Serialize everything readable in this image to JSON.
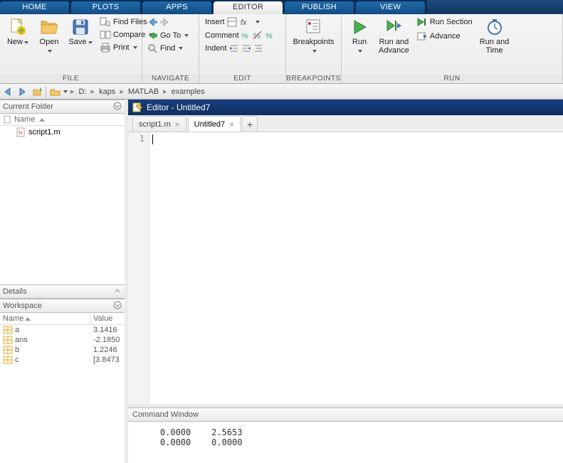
{
  "top_tabs": {
    "home": "HOME",
    "plots": "PLOTS",
    "apps": "APPS",
    "editor": "EDITOR",
    "publish": "PUBLISH",
    "view": "VIEW"
  },
  "ribbon": {
    "file": {
      "label": "FILE",
      "new": "New",
      "open": "Open",
      "save": "Save",
      "find_files": "Find Files",
      "compare": "Compare",
      "print": "Print"
    },
    "navigate": {
      "label": "NAVIGATE",
      "goto": "Go To",
      "find": "Find"
    },
    "edit": {
      "label": "EDIT",
      "insert": "Insert",
      "comment": "Comment",
      "indent": "Indent"
    },
    "breakpoints": {
      "label": "BREAKPOINTS",
      "breakpoints": "Breakpoints"
    },
    "run": {
      "label": "RUN",
      "run": "Run",
      "run_and_advance": "Run and\nAdvance",
      "run_section": "Run Section",
      "advance": "Advance",
      "run_and_time": "Run and\nTime"
    }
  },
  "pathbar": {
    "segments": [
      "D:",
      "kaps",
      "MATLAB",
      "examples"
    ]
  },
  "current_folder": {
    "title": "Current Folder",
    "name_col": "Name",
    "items": [
      {
        "name": "script1.m",
        "icon": "mfile"
      }
    ]
  },
  "details": {
    "title": "Details"
  },
  "workspace": {
    "title": "Workspace",
    "cols": {
      "name": "Name",
      "value": "Value"
    },
    "vars": [
      {
        "name": "a",
        "value": "3.1416"
      },
      {
        "name": "ans",
        "value": "-2.1850"
      },
      {
        "name": "b",
        "value": "1.2246"
      },
      {
        "name": "c",
        "value": "[3.8473"
      }
    ]
  },
  "editor": {
    "title": "Editor - Untitled7",
    "tabs": [
      {
        "label": "script1.m",
        "active": false
      },
      {
        "label": "Untitled7",
        "active": true
      }
    ],
    "gutter": "1",
    "code": ""
  },
  "command_window": {
    "title": "Command Window",
    "output": "    0.0000    2.5653\n    0.0000    0.0000"
  }
}
